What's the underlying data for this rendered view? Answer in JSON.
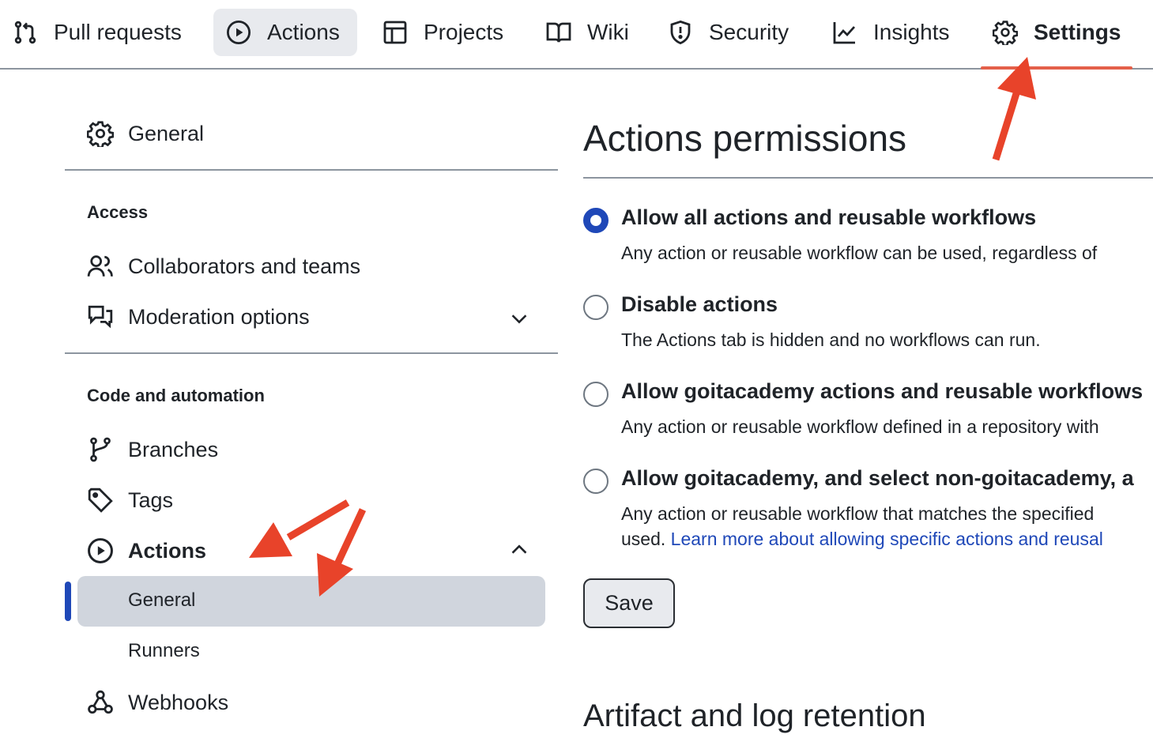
{
  "topnav": {
    "tabs": [
      {
        "label": "Pull requests",
        "icon": "git-pull-request-icon"
      },
      {
        "label": "Actions",
        "icon": "play-circle-icon"
      },
      {
        "label": "Projects",
        "icon": "table-icon"
      },
      {
        "label": "Wiki",
        "icon": "book-icon"
      },
      {
        "label": "Security",
        "icon": "shield-icon"
      },
      {
        "label": "Insights",
        "icon": "graph-icon"
      },
      {
        "label": "Settings",
        "icon": "gear-icon"
      }
    ],
    "selected": "Settings"
  },
  "sidebar": {
    "general": {
      "label": "General",
      "icon": "gear-icon"
    },
    "sections": [
      {
        "heading": "Access",
        "items": [
          {
            "label": "Collaborators and teams",
            "icon": "people-icon"
          },
          {
            "label": "Moderation options",
            "icon": "comment-discussion-icon",
            "expandable": true,
            "expanded": false
          }
        ]
      },
      {
        "heading": "Code and automation",
        "items": [
          {
            "label": "Branches",
            "icon": "git-branch-icon"
          },
          {
            "label": "Tags",
            "icon": "tag-icon"
          },
          {
            "label": "Actions",
            "icon": "play-circle-icon",
            "expandable": true,
            "expanded": true,
            "subitems": [
              {
                "label": "General",
                "active": true
              },
              {
                "label": "Runners",
                "active": false
              }
            ]
          },
          {
            "label": "Webhooks",
            "icon": "webhook-icon"
          }
        ]
      }
    ]
  },
  "main": {
    "title": "Actions permissions",
    "options": [
      {
        "title": "Allow all actions and reusable workflows",
        "description": "Any action or reusable workflow can be used, regardless of",
        "checked": true
      },
      {
        "title": "Disable actions",
        "description": "The Actions tab is hidden and no workflows can run.",
        "checked": false
      },
      {
        "title": "Allow goitacademy actions and reusable workflows",
        "description": "Any action or reusable workflow defined in a repository with",
        "checked": false
      },
      {
        "title": "Allow goitacademy, and select non-goitacademy, a",
        "description": "Any action or reusable workflow that matches the specified",
        "description_line2_prefix": "used. ",
        "link": "Learn more about allowing specific actions and reusal",
        "checked": false
      }
    ],
    "save_label": "Save",
    "next_section_title": "Artifact and log retention"
  },
  "colors": {
    "accent_blue": "#1f48b8",
    "annotation_red": "#e8432a",
    "active_bg": "#d0d5dd"
  }
}
